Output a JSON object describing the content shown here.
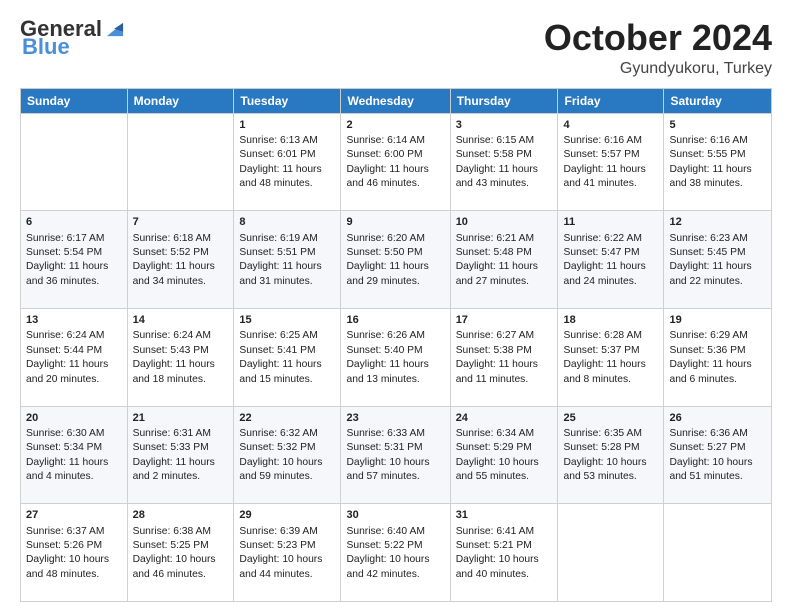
{
  "header": {
    "logo_general": "General",
    "logo_blue": "Blue",
    "month": "October 2024",
    "location": "Gyundyukoru, Turkey"
  },
  "weekdays": [
    "Sunday",
    "Monday",
    "Tuesday",
    "Wednesday",
    "Thursday",
    "Friday",
    "Saturday"
  ],
  "weeks": [
    [
      {
        "day": "",
        "content": ""
      },
      {
        "day": "",
        "content": ""
      },
      {
        "day": "1",
        "content": "Sunrise: 6:13 AM\nSunset: 6:01 PM\nDaylight: 11 hours and 48 minutes."
      },
      {
        "day": "2",
        "content": "Sunrise: 6:14 AM\nSunset: 6:00 PM\nDaylight: 11 hours and 46 minutes."
      },
      {
        "day": "3",
        "content": "Sunrise: 6:15 AM\nSunset: 5:58 PM\nDaylight: 11 hours and 43 minutes."
      },
      {
        "day": "4",
        "content": "Sunrise: 6:16 AM\nSunset: 5:57 PM\nDaylight: 11 hours and 41 minutes."
      },
      {
        "day": "5",
        "content": "Sunrise: 6:16 AM\nSunset: 5:55 PM\nDaylight: 11 hours and 38 minutes."
      }
    ],
    [
      {
        "day": "6",
        "content": "Sunrise: 6:17 AM\nSunset: 5:54 PM\nDaylight: 11 hours and 36 minutes."
      },
      {
        "day": "7",
        "content": "Sunrise: 6:18 AM\nSunset: 5:52 PM\nDaylight: 11 hours and 34 minutes."
      },
      {
        "day": "8",
        "content": "Sunrise: 6:19 AM\nSunset: 5:51 PM\nDaylight: 11 hours and 31 minutes."
      },
      {
        "day": "9",
        "content": "Sunrise: 6:20 AM\nSunset: 5:50 PM\nDaylight: 11 hours and 29 minutes."
      },
      {
        "day": "10",
        "content": "Sunrise: 6:21 AM\nSunset: 5:48 PM\nDaylight: 11 hours and 27 minutes."
      },
      {
        "day": "11",
        "content": "Sunrise: 6:22 AM\nSunset: 5:47 PM\nDaylight: 11 hours and 24 minutes."
      },
      {
        "day": "12",
        "content": "Sunrise: 6:23 AM\nSunset: 5:45 PM\nDaylight: 11 hours and 22 minutes."
      }
    ],
    [
      {
        "day": "13",
        "content": "Sunrise: 6:24 AM\nSunset: 5:44 PM\nDaylight: 11 hours and 20 minutes."
      },
      {
        "day": "14",
        "content": "Sunrise: 6:24 AM\nSunset: 5:43 PM\nDaylight: 11 hours and 18 minutes."
      },
      {
        "day": "15",
        "content": "Sunrise: 6:25 AM\nSunset: 5:41 PM\nDaylight: 11 hours and 15 minutes."
      },
      {
        "day": "16",
        "content": "Sunrise: 6:26 AM\nSunset: 5:40 PM\nDaylight: 11 hours and 13 minutes."
      },
      {
        "day": "17",
        "content": "Sunrise: 6:27 AM\nSunset: 5:38 PM\nDaylight: 11 hours and 11 minutes."
      },
      {
        "day": "18",
        "content": "Sunrise: 6:28 AM\nSunset: 5:37 PM\nDaylight: 11 hours and 8 minutes."
      },
      {
        "day": "19",
        "content": "Sunrise: 6:29 AM\nSunset: 5:36 PM\nDaylight: 11 hours and 6 minutes."
      }
    ],
    [
      {
        "day": "20",
        "content": "Sunrise: 6:30 AM\nSunset: 5:34 PM\nDaylight: 11 hours and 4 minutes."
      },
      {
        "day": "21",
        "content": "Sunrise: 6:31 AM\nSunset: 5:33 PM\nDaylight: 11 hours and 2 minutes."
      },
      {
        "day": "22",
        "content": "Sunrise: 6:32 AM\nSunset: 5:32 PM\nDaylight: 10 hours and 59 minutes."
      },
      {
        "day": "23",
        "content": "Sunrise: 6:33 AM\nSunset: 5:31 PM\nDaylight: 10 hours and 57 minutes."
      },
      {
        "day": "24",
        "content": "Sunrise: 6:34 AM\nSunset: 5:29 PM\nDaylight: 10 hours and 55 minutes."
      },
      {
        "day": "25",
        "content": "Sunrise: 6:35 AM\nSunset: 5:28 PM\nDaylight: 10 hours and 53 minutes."
      },
      {
        "day": "26",
        "content": "Sunrise: 6:36 AM\nSunset: 5:27 PM\nDaylight: 10 hours and 51 minutes."
      }
    ],
    [
      {
        "day": "27",
        "content": "Sunrise: 6:37 AM\nSunset: 5:26 PM\nDaylight: 10 hours and 48 minutes."
      },
      {
        "day": "28",
        "content": "Sunrise: 6:38 AM\nSunset: 5:25 PM\nDaylight: 10 hours and 46 minutes."
      },
      {
        "day": "29",
        "content": "Sunrise: 6:39 AM\nSunset: 5:23 PM\nDaylight: 10 hours and 44 minutes."
      },
      {
        "day": "30",
        "content": "Sunrise: 6:40 AM\nSunset: 5:22 PM\nDaylight: 10 hours and 42 minutes."
      },
      {
        "day": "31",
        "content": "Sunrise: 6:41 AM\nSunset: 5:21 PM\nDaylight: 10 hours and 40 minutes."
      },
      {
        "day": "",
        "content": ""
      },
      {
        "day": "",
        "content": ""
      }
    ]
  ]
}
